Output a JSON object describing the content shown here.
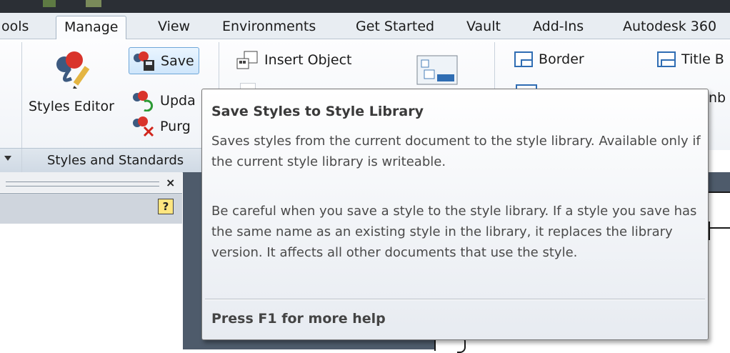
{
  "tabs": [
    {
      "label": "ools",
      "active": false
    },
    {
      "label": "Manage",
      "active": true
    },
    {
      "label": "View",
      "active": false
    },
    {
      "label": "Environments",
      "active": false
    },
    {
      "label": "Get Started",
      "active": false
    },
    {
      "label": "Vault",
      "active": false
    },
    {
      "label": "Add-Ins",
      "active": false
    },
    {
      "label": "Autodesk 360",
      "active": false
    }
  ],
  "ribbon": {
    "styles_editor_label": "Styles Editor",
    "save_label": "Save",
    "update_label": "Upda",
    "purge_label": "Purg",
    "insert_object_label": "Insert Object",
    "border_label": "Border",
    "title_block_label": "Title B",
    "hidden_partial_label": "nb",
    "group_label": "Styles and Standards"
  },
  "tooltip": {
    "title": "Save Styles to Style Library",
    "para1": "Saves styles from the current document to the style library. Available only if the current style library is writeable.",
    "para2": "Be careful when you save a style to the style library. If a style you save has the same name as an existing style in the library, it replaces the library version. It affects all other documents that use the style.",
    "help": "Press F1 for more help"
  },
  "panel": {
    "close_glyph": "×",
    "help_glyph": "?"
  },
  "colors": {
    "accent_blue": "#2f6db3",
    "ribbon_bg": "#f1f4f8",
    "graphics_bg": "#4e5b6b"
  }
}
